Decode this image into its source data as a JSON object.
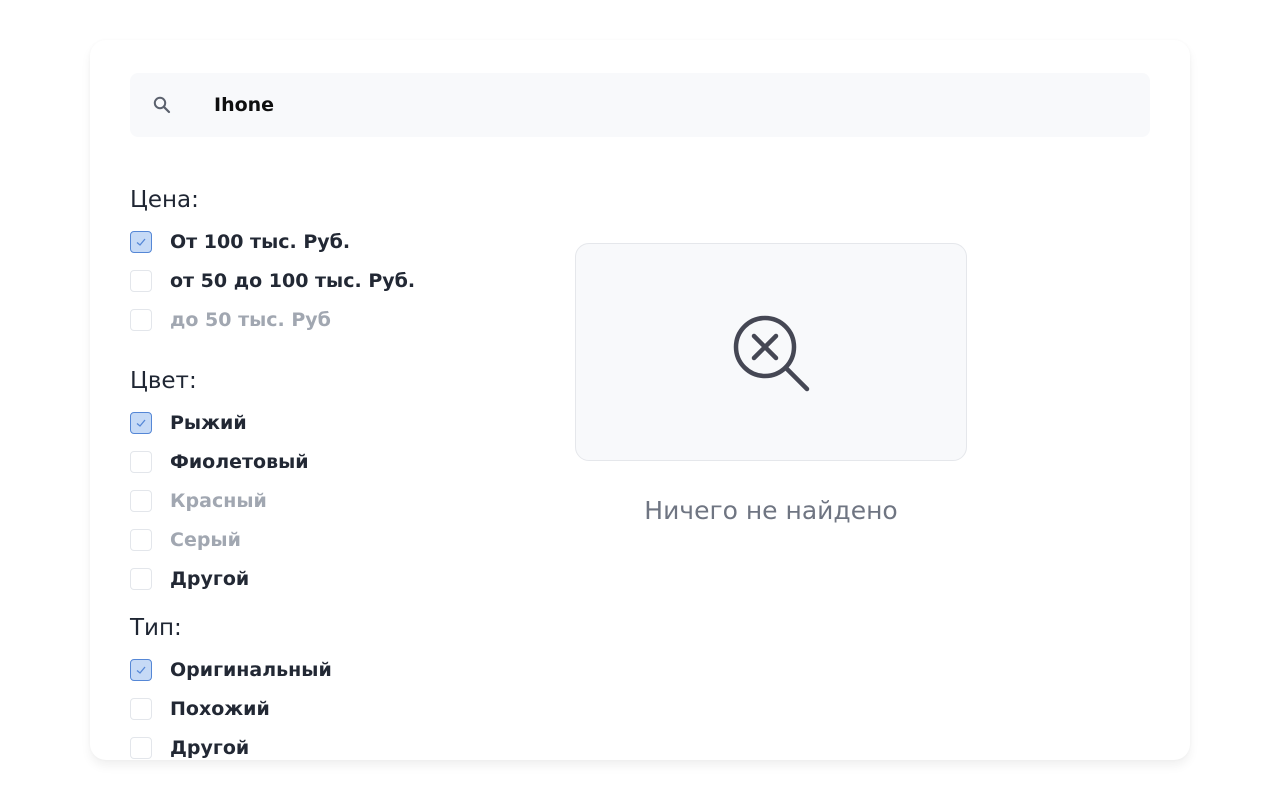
{
  "search": {
    "value": "Ihone",
    "icon": "search-icon"
  },
  "filters": {
    "price": {
      "title": "Цена:",
      "options": [
        {
          "label": "От 100 тыс. Руб.",
          "checked": true,
          "disabled": false
        },
        {
          "label": "от 50 до 100 тыс. Руб.",
          "checked": false,
          "disabled": false
        },
        {
          "label": "до 50 тыс. Руб",
          "checked": false,
          "disabled": true
        }
      ]
    },
    "color": {
      "title": "Цвет:",
      "options": [
        {
          "label": "Рыжий",
          "checked": true,
          "disabled": false
        },
        {
          "label": "Фиолетовый",
          "checked": false,
          "disabled": false
        },
        {
          "label": "Красный",
          "checked": false,
          "disabled": true
        },
        {
          "label": "Серый",
          "checked": false,
          "disabled": true
        },
        {
          "label": "Другой",
          "checked": false,
          "disabled": false
        }
      ]
    },
    "type": {
      "title": "Тип:",
      "options": [
        {
          "label": "Оригинальный",
          "checked": true,
          "disabled": false
        },
        {
          "label": "Похожий",
          "checked": false,
          "disabled": false
        },
        {
          "label": "Другой",
          "checked": false,
          "disabled": false
        }
      ]
    }
  },
  "empty_state": {
    "icon": "search-not-found-icon",
    "text": "Ничего не найдено"
  },
  "colors": {
    "checked_fill": "#c6daf6",
    "checked_border": "#5587d6",
    "text_primary": "#222834",
    "text_disabled": "#a1a7b1",
    "empty_text": "#6f7582"
  }
}
